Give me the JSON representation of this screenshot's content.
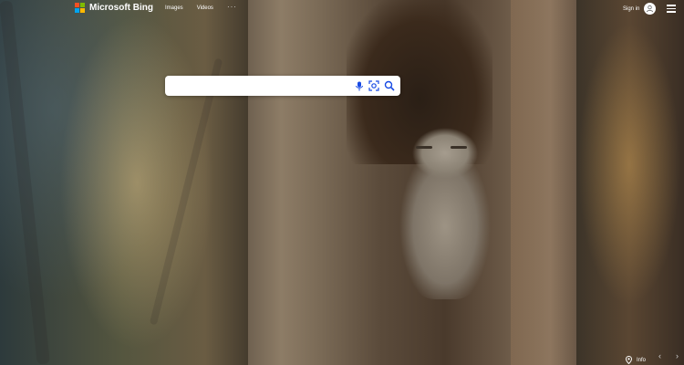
{
  "header": {
    "brand": "Microsoft Bing",
    "brand_colors": [
      "#f25022",
      "#7fba00",
      "#00a4ef",
      "#ffb900"
    ],
    "nav": [
      {
        "label": "Images"
      },
      {
        "label": "Videos"
      }
    ],
    "more_label": "···",
    "sign_in_label": "Sign in"
  },
  "search": {
    "value": "",
    "placeholder": "",
    "icons": [
      "microphone-icon",
      "visual-search-icon",
      "search-icon"
    ],
    "icon_color": "#174ae4"
  },
  "footer": {
    "info_label": "Info",
    "icons": [
      "location-pin-icon",
      "chevron-left-icon",
      "chevron-right-icon"
    ]
  },
  "background": {
    "icons": []
  }
}
